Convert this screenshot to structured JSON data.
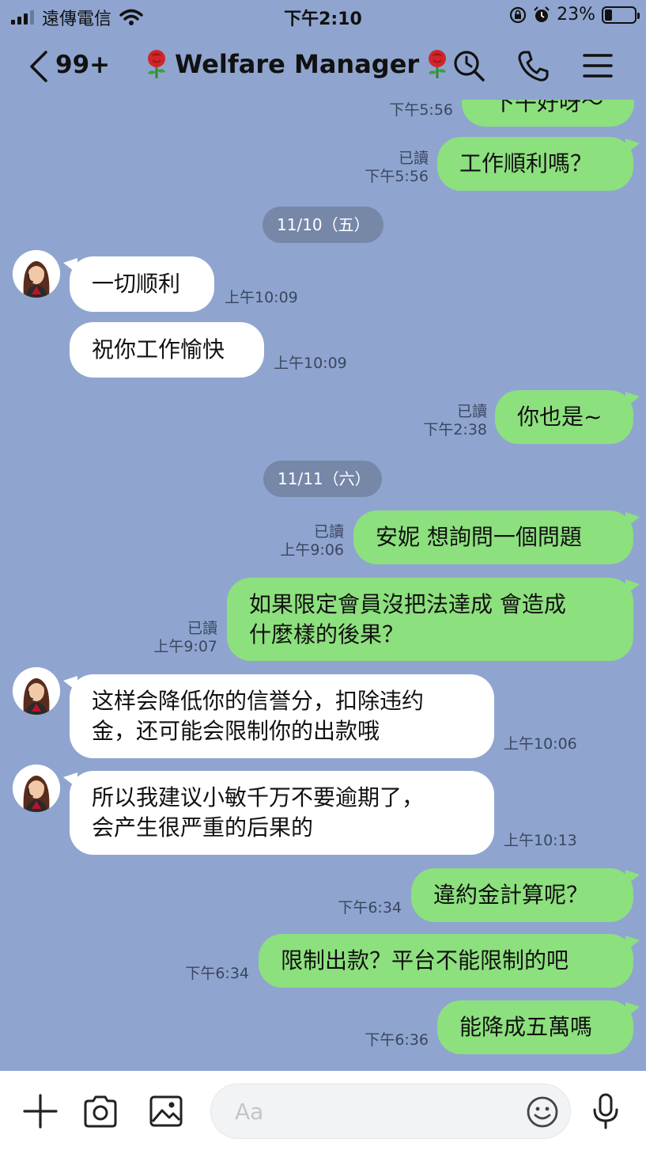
{
  "status_bar": {
    "carrier": "遠傳電信",
    "time": "下午2:10",
    "battery": "23%",
    "battery_level": 0.23
  },
  "header": {
    "unread_count": "99+",
    "title": "Welfare Manager",
    "icons": [
      "back-chevron-icon",
      "rose-icon",
      "search-clock-icon",
      "phone-icon",
      "menu-icon"
    ]
  },
  "colors": {
    "chat_background": "#8fa5cf",
    "sent_bubble": "#8de07e",
    "received_bubble": "#ffffff",
    "date_pill": "#7787a8"
  },
  "messages": [
    {
      "id": "m0",
      "side": "right",
      "lines": [
        "下午好呀～"
      ],
      "read": "",
      "time": "下午5:56"
    },
    {
      "id": "m1",
      "side": "right",
      "lines": [
        "工作順利嗎？"
      ],
      "read": "已讀",
      "time": "下午5:56"
    },
    {
      "id": "d1",
      "type": "date",
      "label": "11/10（五）"
    },
    {
      "id": "m2",
      "side": "left",
      "avatar": true,
      "lines": [
        "一切顺利"
      ],
      "time": "上午10:09"
    },
    {
      "id": "m3",
      "side": "left",
      "lines": [
        "祝你工作愉快"
      ],
      "time": "上午10:09"
    },
    {
      "id": "m4",
      "side": "right",
      "lines": [
        "你也是~"
      ],
      "read": "已讀",
      "time": "下午2:38"
    },
    {
      "id": "d2",
      "type": "date",
      "label": "11/11（六）"
    },
    {
      "id": "m5",
      "side": "right",
      "lines": [
        "安妮 想詢問一個問題"
      ],
      "read": "已讀",
      "time": "上午9:06"
    },
    {
      "id": "m6",
      "side": "right",
      "lines": [
        "如果限定會員沒把法達成 會造成",
        "什麼樣的後果？"
      ],
      "read": "已讀",
      "time": "上午9:07"
    },
    {
      "id": "m7",
      "side": "left",
      "avatar": true,
      "lines": [
        "这样会降低你的信誉分，扣除违约",
        "金，还可能会限制你的出款哦"
      ],
      "time": "上午10:06"
    },
    {
      "id": "m8",
      "side": "left",
      "avatar": true,
      "lines": [
        "所以我建议小敏千万不要逾期了，",
        "会产生很严重的后果的"
      ],
      "time": "上午10:13"
    },
    {
      "id": "m9",
      "side": "right",
      "lines": [
        "違約金計算呢？"
      ],
      "read": "",
      "time": "下午6:34"
    },
    {
      "id": "m10",
      "side": "right",
      "lines": [
        "限制出款？平台不能限制的吧"
      ],
      "read": "",
      "time": "下午6:34"
    },
    {
      "id": "m11",
      "side": "right",
      "lines": [
        "能降成五萬嗎"
      ],
      "read": "",
      "time": "下午6:36"
    }
  ],
  "input_bar": {
    "placeholder": "Aa",
    "value": "",
    "icons": [
      "plus-icon",
      "camera-icon",
      "image-icon",
      "emoji-icon",
      "microphone-icon"
    ]
  }
}
